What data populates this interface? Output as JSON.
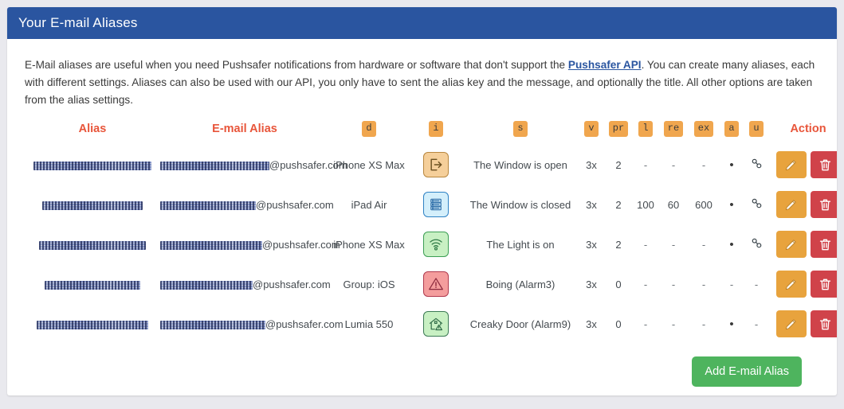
{
  "panel": {
    "title": "Your E-mail Aliases"
  },
  "intro": {
    "part1": "E-Mail aliases are useful when you need Pushsafer notifications from hardware or software that don't support the ",
    "link": "Pushsafer API",
    "part2": ". You can create many aliases, each with different settings. Aliases can also be used with our API, you only have to sent the alias key and the message, and optionally the title. All other options are taken from the alias settings."
  },
  "table": {
    "headers": {
      "alias": "Alias",
      "email_alias": "E-mail Alias",
      "d": "d",
      "i": "i",
      "s": "s",
      "v": "v",
      "pr": "pr",
      "l": "l",
      "re": "re",
      "ex": "ex",
      "a": "a",
      "u": "u",
      "action": "Action"
    },
    "email_domain": "@pushsafer.com",
    "rows": [
      {
        "alias": "[redacted]",
        "alias_width": 148,
        "email_local": "[redacted]",
        "email_local_width": 137,
        "d": "iPhone XS Max",
        "icon": "exit-icon",
        "icon_style": "ib-exit",
        "s": "The Window is open",
        "v": "3x",
        "pr": "2",
        "l": "-",
        "re": "-",
        "ex": "-",
        "a": "•",
        "u": "link-icon"
      },
      {
        "alias": "[redacted]",
        "alias_width": 126,
        "email_local": "[redacted]",
        "email_local_width": 120,
        "d": "iPad Air",
        "icon": "server-icon",
        "icon_style": "ib-serv",
        "s": "The Window is closed",
        "v": "3x",
        "pr": "2",
        "l": "100",
        "re": "60",
        "ex": "600",
        "a": "•",
        "u": "link-icon"
      },
      {
        "alias": "[redacted]",
        "alias_width": 134,
        "email_local": "[redacted]",
        "email_local_width": 128,
        "d": "iPhone XS Max",
        "icon": "wifi-icon",
        "icon_style": "ib-wifi",
        "s": "The Light is on",
        "v": "3x",
        "pr": "2",
        "l": "-",
        "re": "-",
        "ex": "-",
        "a": "•",
        "u": "link-icon"
      },
      {
        "alias": "[redacted]",
        "alias_width": 120,
        "email_local": "[redacted]",
        "email_local_width": 116,
        "d": "Group: iOS",
        "icon": "alarm-warning-icon",
        "icon_style": "ib-alarm",
        "s": "Boing (Alarm3)",
        "v": "3x",
        "pr": "0",
        "l": "-",
        "re": "-",
        "ex": "-",
        "a": "-",
        "u": "-"
      },
      {
        "alias": "[redacted]",
        "alias_width": 140,
        "email_local": "[redacted]",
        "email_local_width": 132,
        "d": "Lumia 550",
        "icon": "home-alert-icon",
        "icon_style": "ib-home",
        "s": "Creaky Door (Alarm9)",
        "v": "3x",
        "pr": "0",
        "l": "-",
        "re": "-",
        "ex": "-",
        "a": "•",
        "u": "-"
      }
    ]
  },
  "footer": {
    "add_button": "Add E-mail Alias"
  },
  "colors": {
    "header_bar": "#2a55a0",
    "accent_orange": "#e8553a",
    "badge_orange": "#f0a64e",
    "edit_button": "#e8a33d",
    "delete_button": "#d0434a",
    "add_button": "#4eb45e",
    "link_blue": "#2a55a0"
  }
}
